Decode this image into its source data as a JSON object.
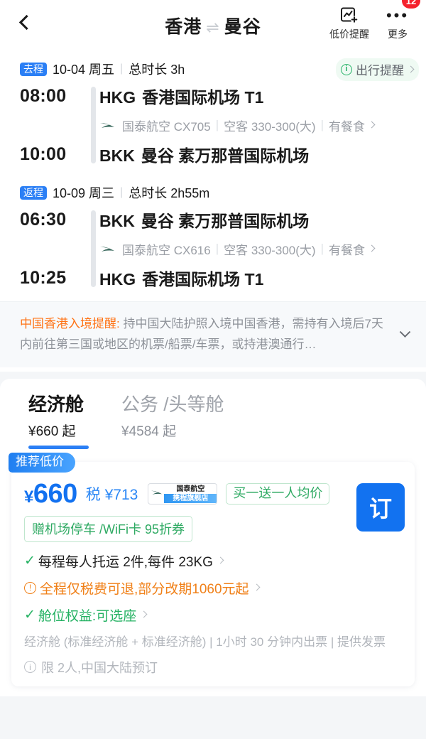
{
  "header": {
    "back_icon": "chevron-left-icon",
    "origin": "香港",
    "arrows": "⇌",
    "destination": "曼谷",
    "price_alert": {
      "icon": "chart-alert-icon",
      "label": "低价提醒"
    },
    "more": {
      "icon": "more-dots-icon",
      "label": "更多"
    },
    "notification_count": "12"
  },
  "segments": [
    {
      "tag": "去程",
      "date": "10-04 周五",
      "separator": "|",
      "duration": "总时长 3h",
      "trip_remind": {
        "icon": "info-circle-icon",
        "label": "出行提醒"
      },
      "depart": {
        "time": "08:00",
        "code": "HKG",
        "airport": "香港国际机场 T1"
      },
      "arrive": {
        "time": "10:00",
        "code": "BKK",
        "airport": "曼谷 素万那普国际机场"
      },
      "flight": {
        "airline_icon": "cathay-brushwing-icon",
        "airline": "国泰航空 CX705",
        "aircraft": "空客 330-300(大)",
        "meal": "有餐食"
      }
    },
    {
      "tag": "返程",
      "date": "10-09 周三",
      "separator": "|",
      "duration": "总时长 2h55m",
      "depart": {
        "time": "06:30",
        "code": "BKK",
        "airport": "曼谷 素万那普国际机场"
      },
      "arrive": {
        "time": "10:25",
        "code": "HKG",
        "airport": "香港国际机场 T1"
      },
      "flight": {
        "airline_icon": "cathay-brushwing-icon",
        "airline": "国泰航空 CX616",
        "aircraft": "空客 330-300(大)",
        "meal": "有餐食"
      }
    }
  ],
  "visa_notice": {
    "highlight": "中国香港入境提醒:",
    "body": " 持中国大陆护照入境中国香港，需持有入境后7天内前往第三国或地区的机票/船票/车票，或持港澳通行…",
    "expand_icon": "chevron-down-icon"
  },
  "cabin_tabs": [
    {
      "name": "经济舱",
      "price": "¥660 起",
      "active": true
    },
    {
      "name": "公务 /头等舱",
      "price": "¥4584 起",
      "active": false
    }
  ],
  "offer": {
    "recommend_badge": "推荐低价",
    "price": "660",
    "currency": "¥",
    "tax": "税 ¥713",
    "airline_chip": {
      "icon": "cathay-brushwing-icon",
      "top": "国泰航空",
      "bottom": "携程旗舰店"
    },
    "promo_chip": "买一送一人均价",
    "book_button": "订",
    "coupon_chip": "赠机场停车 /WiFi卡 95折券",
    "benefits": [
      {
        "icon": "check-icon",
        "text": "每程每人托运 2件,每件 23KG",
        "style": "dark"
      },
      {
        "icon": "warning-circle-icon",
        "text": "全程仅税费可退,部分改期1060元起",
        "style": "orange"
      },
      {
        "icon": "check-icon",
        "text": "舱位权益:可选座",
        "style": "green"
      }
    ],
    "fine_print": "经济舱 (标准经济舱 + 标准经济舱) | 1小时 30 分钟内出票 | 提供发票",
    "limit_note": {
      "icon": "info-circle-icon",
      "text": "限 2人,中国大陆预订"
    }
  }
}
